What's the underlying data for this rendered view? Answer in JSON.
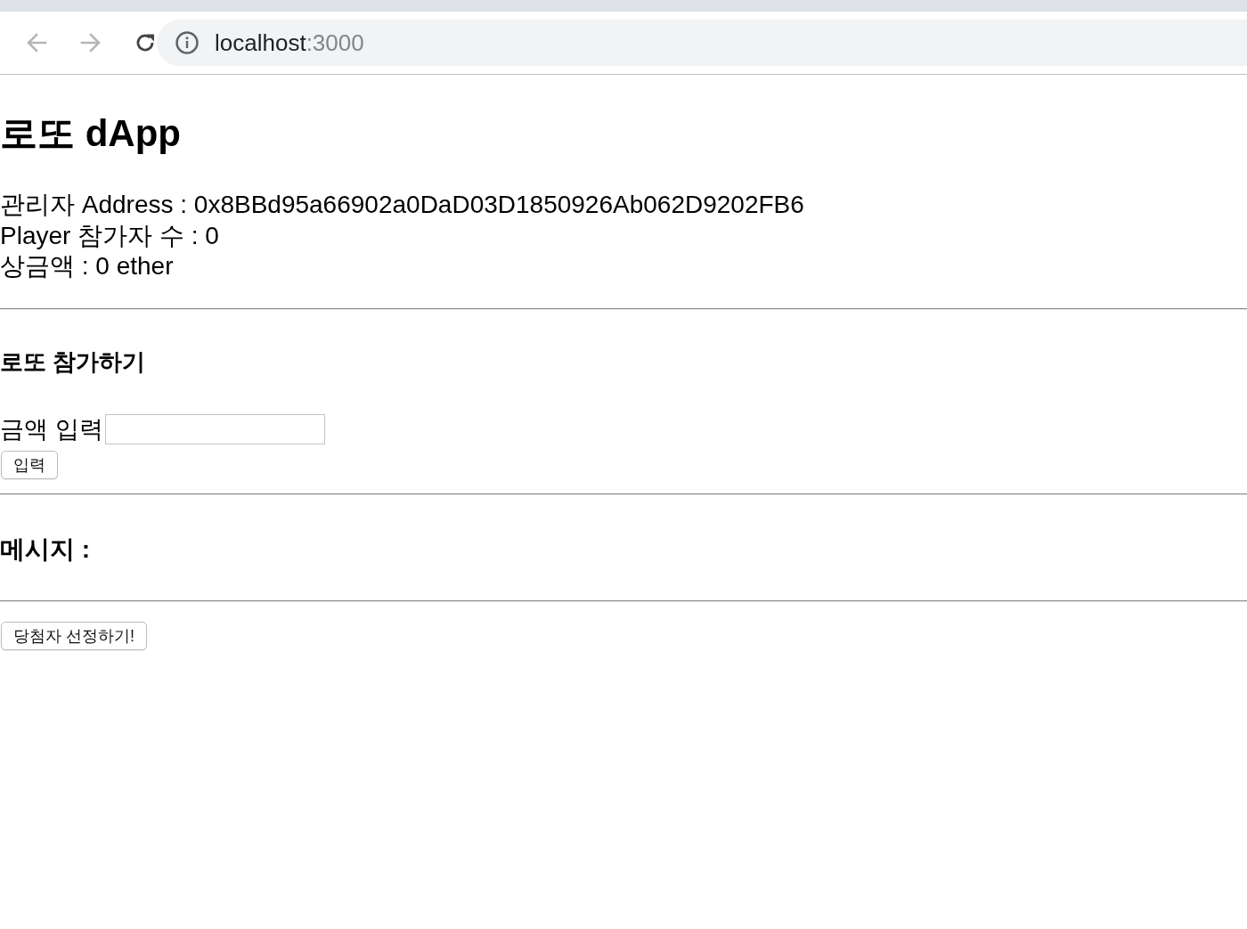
{
  "browser": {
    "nav_buttons": [
      {
        "kind": "back",
        "disabled": true
      },
      {
        "kind": "forward",
        "disabled": true
      },
      {
        "kind": "reload",
        "disabled": false
      }
    ],
    "address": {
      "host": "localhost",
      "port": ":3000"
    }
  },
  "page": {
    "title": "로또 dApp",
    "info_lines": [
      "관리자 Address : 0x8BBd95a66902a0DaD03D1850926Ab062D9202FB6",
      "Player 참가자 수 : 0",
      "상금액 : 0 ether"
    ],
    "join": {
      "heading": "로또 참가하기",
      "amount_label": "금액 입력",
      "submit_button": "입력"
    },
    "message": {
      "heading": "메시지 :"
    },
    "pick_winner_button": "당첨자 선정하기!"
  }
}
